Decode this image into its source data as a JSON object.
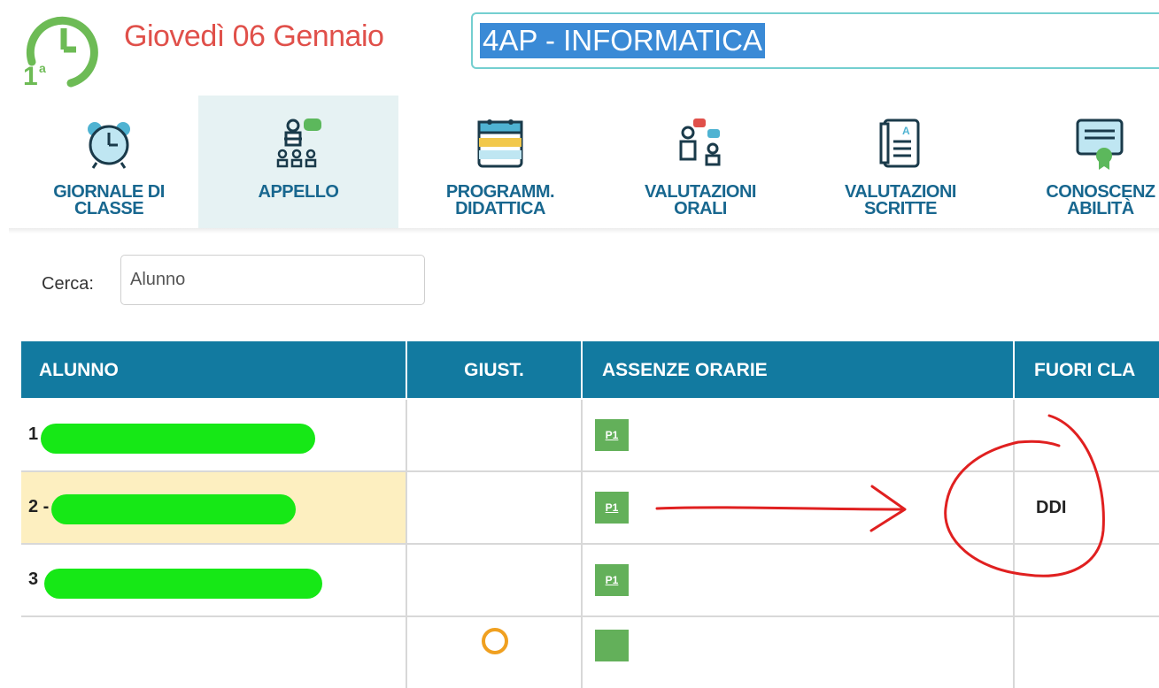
{
  "header": {
    "date": "Giovedì 06 Gennaio",
    "class_name": "4AP - INFORMATICA"
  },
  "toolbar": {
    "items": [
      {
        "label": "GIORNALE DI\nCLASSE",
        "icon": "alarm-clock-icon",
        "active": false
      },
      {
        "label": "APPELLO",
        "icon": "roll-call-icon",
        "active": true
      },
      {
        "label": "PROGRAMM.\nDIDATTICA",
        "icon": "calendar-icon",
        "active": false
      },
      {
        "label": "VALUTAZIONI\nORALI",
        "icon": "oral-grades-icon",
        "active": false
      },
      {
        "label": "VALUTAZIONI\nSCRITTE",
        "icon": "written-grades-icon",
        "active": false
      },
      {
        "label": "CONOSCENZ\nABILITÀ",
        "icon": "certificate-icon",
        "active": false
      }
    ]
  },
  "search": {
    "label": "Cerca:",
    "placeholder": "Alunno"
  },
  "table": {
    "headers": {
      "alunno": "ALUNNO",
      "giust": "GIUST.",
      "assenze": "ASSENZE ORARIE",
      "fuori": "FUORI CLA"
    },
    "rows": [
      {
        "num": "1",
        "badge": "P1",
        "fuori": "",
        "highlighted": false
      },
      {
        "num": "2 -",
        "badge": "P1",
        "fuori": "DDI",
        "highlighted": true
      },
      {
        "num": "3",
        "badge": "P1",
        "fuori": "",
        "highlighted": false
      }
    ]
  },
  "colors": {
    "date": "#e0504a",
    "header_bg": "#127aa0",
    "toolbar_label": "#18678f",
    "badge": "#63b05a",
    "highlight_row": "#fdefc0",
    "annotation": "#e02020"
  }
}
